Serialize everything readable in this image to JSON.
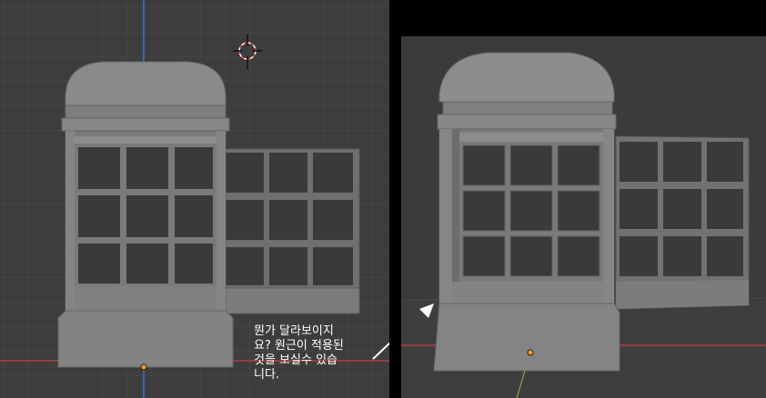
{
  "annotation": {
    "text": "뭔가 달라보이지\n요? 원근이 적용된\n것을 보실수 있습\n니다."
  },
  "viewports": {
    "left": {
      "projection": "orthographic"
    },
    "right": {
      "projection": "perspective"
    }
  },
  "colors": {
    "grid_bg": "#3d3d3d",
    "grid_line": "#4a4a4a",
    "x_axis": "#c0454a",
    "y_axis": "#3f75c8",
    "model": "#8a8a8a",
    "model_dark": "#6c6c6c",
    "origin": "#ff9b2c"
  },
  "icons": [
    "3d-cursor-icon",
    "origin-dot-icon",
    "arrow-icon"
  ]
}
